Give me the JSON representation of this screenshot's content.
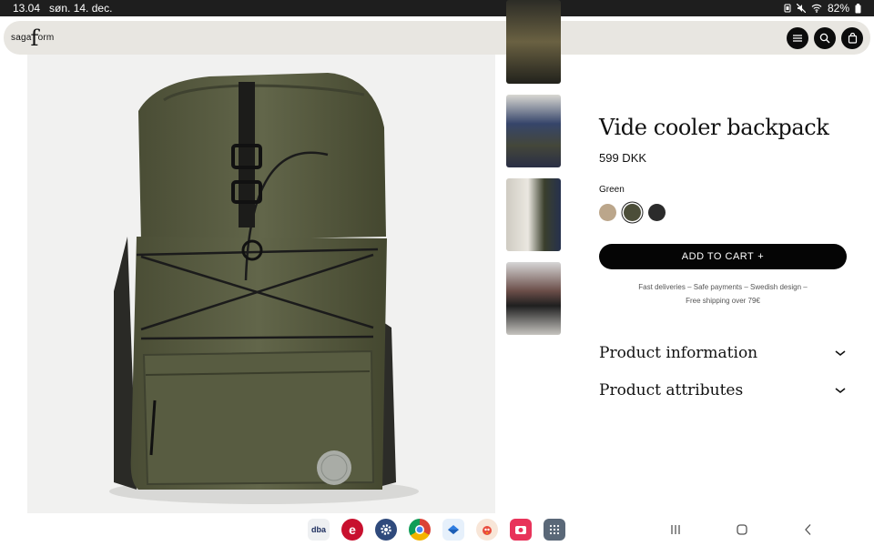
{
  "status": {
    "time": "13.04",
    "date": "søn. 14. dec.",
    "battery": "82%"
  },
  "header": {
    "logo_left": "saga",
    "logo_f": "f",
    "logo_right": "orm"
  },
  "product": {
    "title": "Vide cooler backpack",
    "price": "599 DKK",
    "color_label": "Green",
    "swatches": [
      {
        "name": "sand",
        "color": "#bba68b"
      },
      {
        "name": "green",
        "color": "#4c4e39"
      },
      {
        "name": "black",
        "color": "#2b2b2b"
      }
    ],
    "selected_swatch": "green",
    "add_to_cart": "ADD TO CART",
    "add_symbol": "+",
    "info_line1": "Fast deliveries – Safe payments – Swedish design –",
    "info_line2": "Free shipping over 79€",
    "accordion": [
      {
        "label": "Product information"
      },
      {
        "label": "Product attributes"
      }
    ]
  },
  "dock": {
    "apps": [
      "dba",
      "e",
      "settings",
      "chrome",
      "mail",
      "bird-game",
      "camera-app",
      "apps-grid"
    ]
  },
  "nav": {
    "recents": "|||",
    "home": "○",
    "back": "<"
  },
  "colors": {
    "accent": "#050505",
    "header_bg": "#e8e6e1",
    "bag_green": "#5b5f43"
  }
}
